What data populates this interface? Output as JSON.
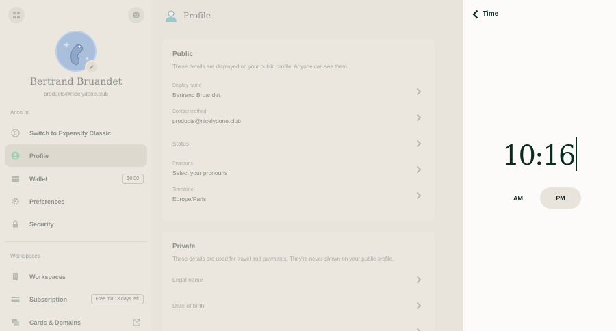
{
  "sidebar": {
    "user": {
      "name": "Bertrand Bruandet",
      "email": "products@nicelydone.club"
    },
    "account_label": "Account",
    "account_items": [
      {
        "label": "Switch to Expensify Classic",
        "icon": "expensify-classic-icon"
      },
      {
        "label": "Profile",
        "icon": "profile-icon",
        "active": true
      },
      {
        "label": "Wallet",
        "icon": "wallet-icon",
        "badge": "$0.00"
      },
      {
        "label": "Preferences",
        "icon": "gear-icon"
      },
      {
        "label": "Security",
        "icon": "lock-icon"
      }
    ],
    "workspaces_label": "Workspaces",
    "workspace_items": [
      {
        "label": "Workspaces",
        "icon": "building-icon"
      },
      {
        "label": "Subscription",
        "icon": "credit-card-icon",
        "badge": "Free trial: 3 days left"
      },
      {
        "label": "Cards & Domains",
        "icon": "cards-icon"
      }
    ]
  },
  "main": {
    "title": "Profile",
    "public": {
      "title": "Public",
      "subtitle": "These details are displayed on your public profile. Anyone can see them.",
      "fields": [
        {
          "label": "Display name",
          "value": "Bertrand Bruandet"
        },
        {
          "label": "Contact method",
          "value": "products@nicelydone.club"
        },
        {
          "label": "",
          "value": "Status"
        },
        {
          "label": "Pronouns",
          "value": "Select your pronouns"
        },
        {
          "label": "Timezone",
          "value": "Europe/Paris"
        }
      ]
    },
    "private": {
      "title": "Private",
      "subtitle": "These details are used for travel and payments. They're never shown on your public profile.",
      "fields": [
        {
          "label": "",
          "value": "Legal name"
        },
        {
          "label": "",
          "value": "Date of birth"
        }
      ]
    }
  },
  "panel": {
    "title": "Time",
    "time": "10:16",
    "am_label": "AM",
    "pm_label": "PM",
    "selected_period": "PM"
  },
  "colors": {
    "accent_dark": "#0b2a22",
    "backdrop": "#e8e4dc"
  }
}
